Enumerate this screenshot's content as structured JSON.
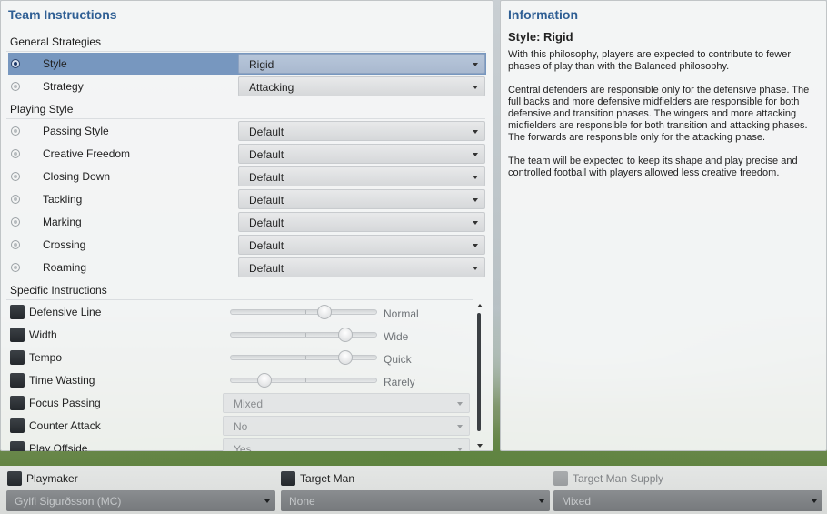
{
  "team_instructions": {
    "title": "Team Instructions",
    "general_strategies": {
      "heading": "General Strategies",
      "rows": [
        {
          "label": "Style",
          "value": "Rigid"
        },
        {
          "label": "Strategy",
          "value": "Attacking"
        }
      ]
    },
    "playing_style": {
      "heading": "Playing Style",
      "rows": [
        {
          "label": "Passing Style",
          "value": "Default"
        },
        {
          "label": "Creative Freedom",
          "value": "Default"
        },
        {
          "label": "Closing Down",
          "value": "Default"
        },
        {
          "label": "Tackling",
          "value": "Default"
        },
        {
          "label": "Marking",
          "value": "Default"
        },
        {
          "label": "Crossing",
          "value": "Default"
        },
        {
          "label": "Roaming",
          "value": "Default"
        }
      ]
    },
    "specific_instructions": {
      "heading": "Specific Instructions",
      "sliders": [
        {
          "label": "Defensive Line",
          "value_label": "Normal",
          "level": 0.65
        },
        {
          "label": "Width",
          "value_label": "Wide",
          "level": 0.81
        },
        {
          "label": "Tempo",
          "value_label": "Quick",
          "level": 0.81
        },
        {
          "label": "Time Wasting",
          "value_label": "Rarely",
          "level": 0.2
        }
      ],
      "dropdowns": [
        {
          "label": "Focus Passing",
          "value": "Mixed"
        },
        {
          "label": "Counter Attack",
          "value": "No"
        },
        {
          "label": "Play Offside",
          "value": "Yes"
        }
      ]
    }
  },
  "information": {
    "title": "Information",
    "subtitle": "Style: Rigid",
    "paragraphs": [
      "With this philosophy, players are expected to contribute to fewer phases of play than with the Balanced philosophy.",
      "Central defenders are responsible only for the defensive phase. The full backs and more defensive midfielders are responsible for both defensive and transition phases. The wingers and more attacking midfielders are responsible for both transition and attacking phases. The forwards are responsible only for the attacking phase.",
      "The team will be expected to keep its shape and play precise and controlled football with players allowed less creative freedom."
    ]
  },
  "bottom": {
    "playmaker": {
      "label": "Playmaker",
      "value": "Gylfi Sigurðsson (MC)"
    },
    "target_man": {
      "label": "Target Man",
      "value": "None"
    },
    "target_man_supply": {
      "label": "Target Man Supply",
      "value": "Mixed"
    }
  },
  "colors": {
    "title_blue": "#2f5f94",
    "selected_row": "#7797bf"
  }
}
